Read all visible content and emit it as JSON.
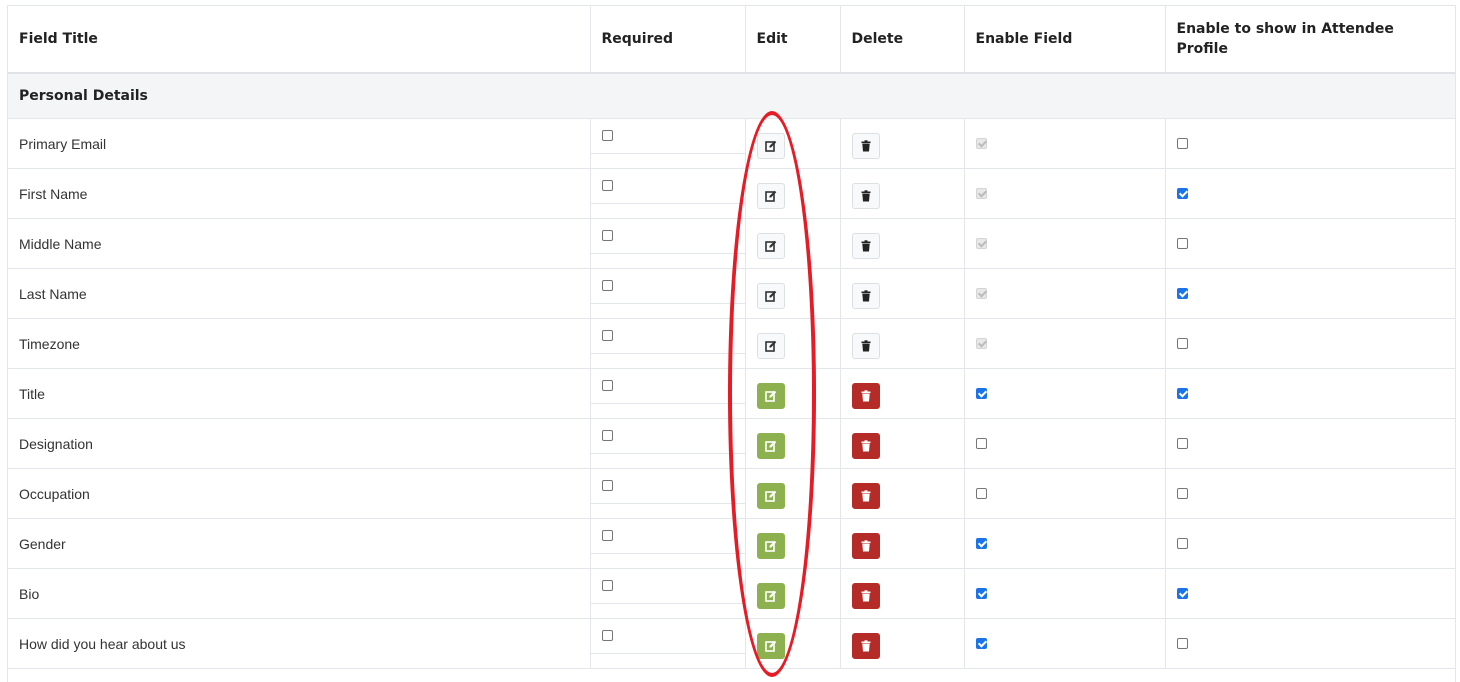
{
  "table": {
    "headers": {
      "field_title": "Field Title",
      "required": "Required",
      "edit": "Edit",
      "delete": "Delete",
      "enable_field": "Enable Field",
      "enable_profile_line1": "Enable to show in Attendee",
      "enable_profile_line2": "Profile"
    },
    "section_title": "Personal Details",
    "rows": [
      {
        "title": "Primary Email",
        "required": false,
        "action_style": "light",
        "enable_field": "disabled-checked",
        "show_in_profile": false
      },
      {
        "title": "First Name",
        "required": false,
        "action_style": "light",
        "enable_field": "disabled-checked",
        "show_in_profile": true
      },
      {
        "title": "Middle Name",
        "required": false,
        "action_style": "light",
        "enable_field": "disabled-checked",
        "show_in_profile": false
      },
      {
        "title": "Last Name",
        "required": false,
        "action_style": "light",
        "enable_field": "disabled-checked",
        "show_in_profile": true
      },
      {
        "title": "Timezone",
        "required": false,
        "action_style": "light",
        "enable_field": "disabled-checked",
        "show_in_profile": false
      },
      {
        "title": "Title",
        "required": false,
        "action_style": "colored",
        "enable_field": "checked",
        "show_in_profile": true
      },
      {
        "title": "Designation",
        "required": false,
        "action_style": "colored",
        "enable_field": "unchecked",
        "show_in_profile": false
      },
      {
        "title": "Occupation",
        "required": false,
        "action_style": "colored",
        "enable_field": "unchecked",
        "show_in_profile": false
      },
      {
        "title": "Gender",
        "required": false,
        "action_style": "colored",
        "enable_field": "checked",
        "show_in_profile": false
      },
      {
        "title": "Bio",
        "required": false,
        "action_style": "colored",
        "enable_field": "checked",
        "show_in_profile": true
      },
      {
        "title": "How did you hear about us",
        "required": false,
        "action_style": "colored",
        "enable_field": "checked",
        "show_in_profile": false
      }
    ]
  },
  "icons": {
    "edit": "edit-icon",
    "delete": "trash-icon"
  },
  "colors": {
    "checkbox_checked": "#1a73e8",
    "edit_button_active": "#8db14f",
    "delete_button_active": "#b52b27",
    "annotation_ellipse": "#e51b25"
  }
}
